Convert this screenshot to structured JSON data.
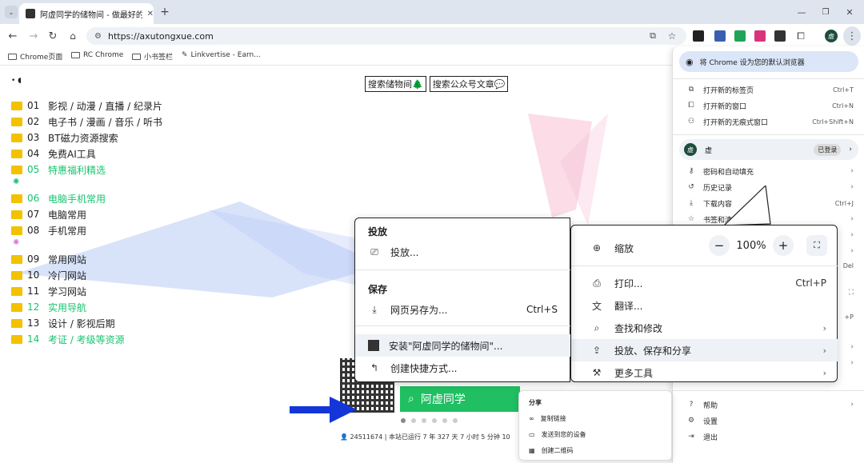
{
  "tab": {
    "title": "阿虚同学的储物间 - 做最好的..."
  },
  "address": {
    "url": "https://axutongxue.com"
  },
  "bookmarks": [
    {
      "label": "Chrome页面"
    },
    {
      "label": "RC Chrome"
    },
    {
      "label": "小书签栏"
    },
    {
      "label": "Linkvertise - Earn..."
    }
  ],
  "page": {
    "search_buttons": [
      "搜索储物间🌲",
      "搜索公众号文章💬"
    ],
    "items": [
      {
        "num": "01",
        "label": "影视 / 动漫 / 直播 / 纪录片"
      },
      {
        "num": "02",
        "label": "电子书 / 漫画 / 音乐 / 听书"
      },
      {
        "num": "03",
        "label": "BT磁力资源搜索"
      },
      {
        "num": "04",
        "label": "免费AI工具"
      },
      {
        "num": "05",
        "label": "特惠福利精选"
      },
      {
        "num": "06",
        "label": "电脑手机常用"
      },
      {
        "num": "07",
        "label": "电脑常用"
      },
      {
        "num": "08",
        "label": "手机常用"
      },
      {
        "num": "09",
        "label": "常用网站"
      },
      {
        "num": "10",
        "label": "冷门网站"
      },
      {
        "num": "11",
        "label": "学习网站"
      },
      {
        "num": "12",
        "label": "实用导航"
      },
      {
        "num": "13",
        "label": "设计 / 影视后期"
      },
      {
        "num": "14",
        "label": "考证 / 考级等资源"
      }
    ],
    "green_search": "阿虚同学",
    "stats": "24511674 | 本站已运行 7 年 327 天 7 小时 5 分钟 10"
  },
  "chrome_menu": {
    "default_browser": "将 Chrome 设为您的默认浏览器",
    "new_tab": "打开新的标签页",
    "new_tab_sc": "Ctrl+T",
    "new_window": "打开新的窗口",
    "new_window_sc": "Ctrl+N",
    "incognito": "打开新的无痕式窗口",
    "incognito_sc": "Ctrl+Shift+N",
    "profile_name": "虚",
    "profile_badge": "已登录",
    "passwords": "密码和自动填充",
    "history": "历史记录",
    "downloads": "下载内容",
    "downloads_sc": "Ctrl+J",
    "bookmarks": "书签和清单",
    "frag_del": "Del",
    "frag_p": "+P",
    "help": "帮助",
    "settings": "设置",
    "exit": "退出"
  },
  "main_submenu": {
    "zoom": "缩放",
    "zoom_value": "100%",
    "print": "打印...",
    "print_sc": "Ctrl+P",
    "translate": "翻译...",
    "find": "查找和修改",
    "cast_save_share": "投放、保存和分享",
    "more_tools": "更多工具"
  },
  "cast_submenu": {
    "cast_head": "投放",
    "cast": "投放...",
    "save_head": "保存",
    "save_as": "网页另存为...",
    "save_as_sc": "Ctrl+S",
    "install": "安装\"阿虚同学的储物间\"...",
    "shortcut": "创建快捷方式..."
  },
  "share_menu": {
    "head": "分享",
    "copy_link": "复制链接",
    "send_device": "发送到您的设备",
    "qr": "创建二维码"
  }
}
